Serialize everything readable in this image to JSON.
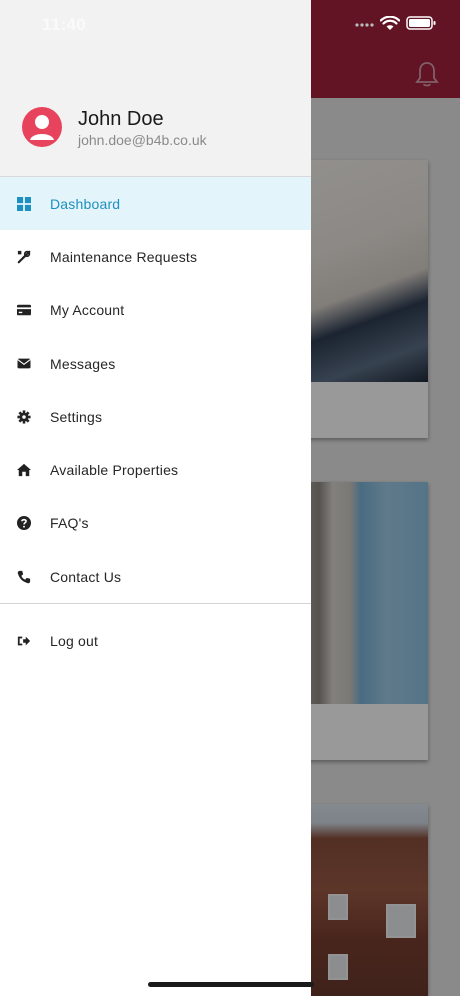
{
  "status_bar": {
    "time": "11:40"
  },
  "user": {
    "name": "John Doe",
    "email": "john.doe@b4b.co.uk"
  },
  "menu": [
    {
      "label": "Dashboard",
      "icon": "dashboard-icon",
      "active": true
    },
    {
      "label": "Maintenance Requests",
      "icon": "tools-icon",
      "active": false
    },
    {
      "label": "My Account",
      "icon": "credit-card-icon",
      "active": false
    },
    {
      "label": "Messages",
      "icon": "envelope-icon",
      "active": false
    },
    {
      "label": "Settings",
      "icon": "gear-icon",
      "active": false
    },
    {
      "label": "Available Properties",
      "icon": "home-icon",
      "active": false
    },
    {
      "label": "FAQ's",
      "icon": "question-circle-icon",
      "active": false
    },
    {
      "label": "Contact Us",
      "icon": "phone-icon",
      "active": false
    }
  ],
  "logout": {
    "label": "Log out",
    "icon": "sign-out-icon"
  },
  "colors": {
    "brand": "#a3213d",
    "avatar": "#e8435c",
    "active_item_bg": "#e3f4fb",
    "active_item_text": "#1f8fbf"
  }
}
